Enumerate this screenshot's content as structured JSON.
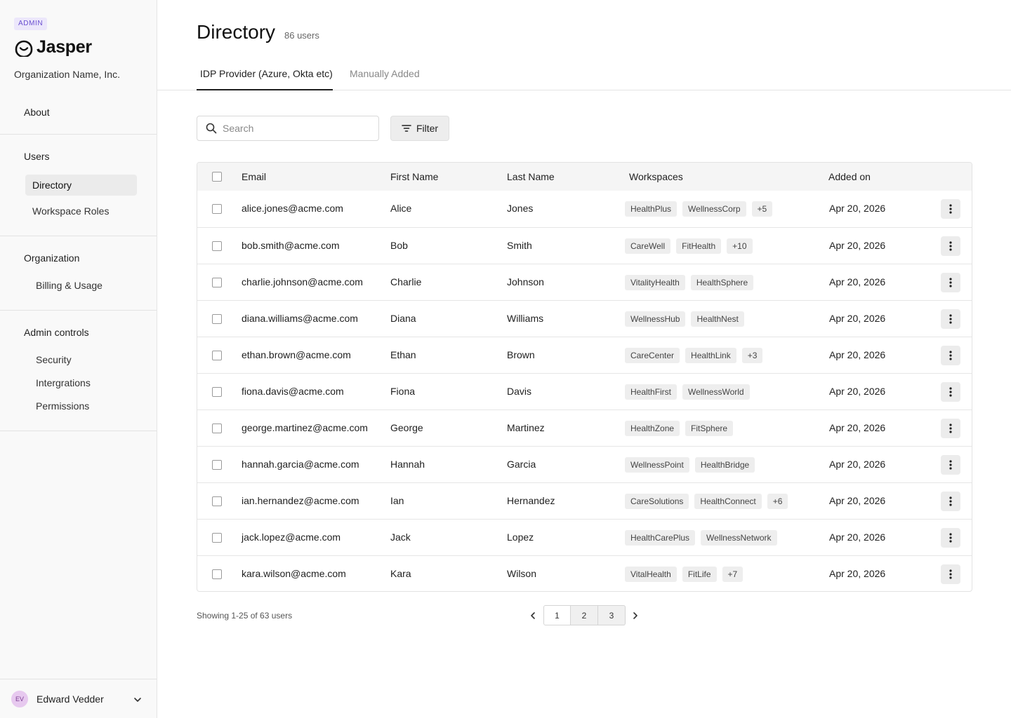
{
  "sidebar": {
    "badge": "ADMIN",
    "brand": "Jasper",
    "org_name": "Organization Name, Inc.",
    "about": "About",
    "users_heading": "Users",
    "users_items": [
      {
        "label": "Directory",
        "active": true
      },
      {
        "label": "Workspace Roles",
        "active": false
      }
    ],
    "organization_heading": "Organization",
    "organization_items": [
      {
        "label": "Billing & Usage"
      }
    ],
    "admin_heading": "Admin controls",
    "admin_items": [
      {
        "label": "Security"
      },
      {
        "label": "Intergrations"
      },
      {
        "label": "Permissions"
      }
    ],
    "user": {
      "initials": "EV",
      "name": "Edward Vedder"
    }
  },
  "header": {
    "title": "Directory",
    "count": "86 users",
    "tabs": [
      {
        "label": "IDP Provider (Azure, Okta etc)",
        "active": true
      },
      {
        "label": "Manually Added",
        "active": false
      }
    ]
  },
  "toolbar": {
    "search_placeholder": "Search",
    "filter_label": "Filter"
  },
  "table": {
    "columns": [
      "Email",
      "First Name",
      "Last Name",
      "Workspaces",
      "Added on"
    ],
    "rows": [
      {
        "email": "alice.jones@acme.com",
        "first": "Alice",
        "last": "Jones",
        "workspaces": [
          "HealthPlus",
          "WellnessCorp",
          "+5"
        ],
        "added": "Apr 20, 2026"
      },
      {
        "email": "bob.smith@acme.com",
        "first": "Bob",
        "last": "Smith",
        "workspaces": [
          "CareWell",
          "FitHealth",
          "+10"
        ],
        "added": "Apr 20, 2026"
      },
      {
        "email": "charlie.johnson@acme.com",
        "first": "Charlie",
        "last": "Johnson",
        "workspaces": [
          "VitalityHealth",
          "HealthSphere"
        ],
        "added": "Apr 20, 2026"
      },
      {
        "email": "diana.williams@acme.com",
        "first": "Diana",
        "last": "Williams",
        "workspaces": [
          "WellnessHub",
          "HealthNest"
        ],
        "added": "Apr 20, 2026"
      },
      {
        "email": "ethan.brown@acme.com",
        "first": "Ethan",
        "last": "Brown",
        "workspaces": [
          "CareCenter",
          "HealthLink",
          "+3"
        ],
        "added": "Apr 20, 2026"
      },
      {
        "email": "fiona.davis@acme.com",
        "first": "Fiona",
        "last": "Davis",
        "workspaces": [
          "HealthFirst",
          "WellnessWorld"
        ],
        "added": "Apr 20, 2026"
      },
      {
        "email": "george.martinez@acme.com",
        "first": "George",
        "last": "Martinez",
        "workspaces": [
          "HealthZone",
          "FitSphere"
        ],
        "added": "Apr 20, 2026"
      },
      {
        "email": "hannah.garcia@acme.com",
        "first": "Hannah",
        "last": "Garcia",
        "workspaces": [
          "WellnessPoint",
          "HealthBridge"
        ],
        "added": "Apr 20, 2026"
      },
      {
        "email": "ian.hernandez@acme.com",
        "first": "Ian",
        "last": "Hernandez",
        "workspaces": [
          "CareSolutions",
          "HealthConnect",
          "+6"
        ],
        "added": "Apr 20, 2026"
      },
      {
        "email": "jack.lopez@acme.com",
        "first": "Jack",
        "last": "Lopez",
        "workspaces": [
          "HealthCarePlus",
          "WellnessNetwork"
        ],
        "added": "Apr 20, 2026"
      },
      {
        "email": "kara.wilson@acme.com",
        "first": "Kara",
        "last": "Wilson",
        "workspaces": [
          "VitalHealth",
          "FitLife",
          "+7"
        ],
        "added": "Apr 20, 2026"
      }
    ]
  },
  "pagination": {
    "showing": "Showing 1-25 of 63 users",
    "pages": [
      "1",
      "2",
      "3"
    ],
    "current": "1"
  },
  "colors": {
    "accent": "#6a4fd0",
    "badge_bg": "#ece7fb",
    "avatar_bg": "#e7c9ef"
  }
}
